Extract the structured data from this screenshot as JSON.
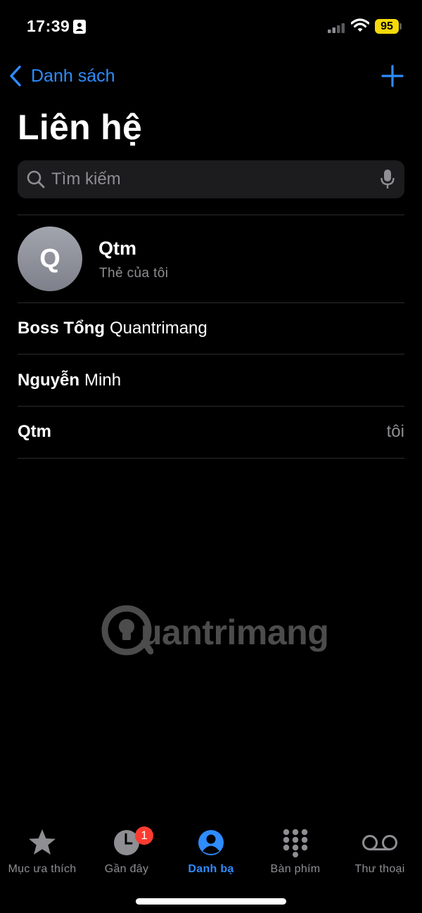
{
  "status_bar": {
    "time": "17:39",
    "battery": "95"
  },
  "nav": {
    "back_label": "Danh sách",
    "title": "Liên hệ"
  },
  "search": {
    "placeholder": "Tìm kiếm"
  },
  "my_card": {
    "initial": "Q",
    "name": "Qtm",
    "subtitle": "Thẻ của tôi"
  },
  "contacts": [
    {
      "first": "Boss Tổng",
      "last": "Quantrimang",
      "tag": ""
    },
    {
      "first": "Nguyễn",
      "last": "Minh",
      "tag": ""
    },
    {
      "first": "Qtm",
      "last": "",
      "tag": "tôi"
    }
  ],
  "watermark": {
    "text": "uantrimang"
  },
  "tabs": [
    {
      "label": "Mục ưa thích",
      "icon": "star-icon",
      "active": false
    },
    {
      "label": "Gần đây",
      "icon": "clock-icon",
      "active": false,
      "badge": "1"
    },
    {
      "label": "Danh bạ",
      "icon": "person-circle-icon",
      "active": true
    },
    {
      "label": "Bàn phím",
      "icon": "keypad-icon",
      "active": false
    },
    {
      "label": "Thư thoại",
      "icon": "voicemail-icon",
      "active": false
    }
  ],
  "colors": {
    "accent": "#2f8cff",
    "background": "#000000",
    "badge": "#ff3b30",
    "battery": "#f5d90a"
  }
}
